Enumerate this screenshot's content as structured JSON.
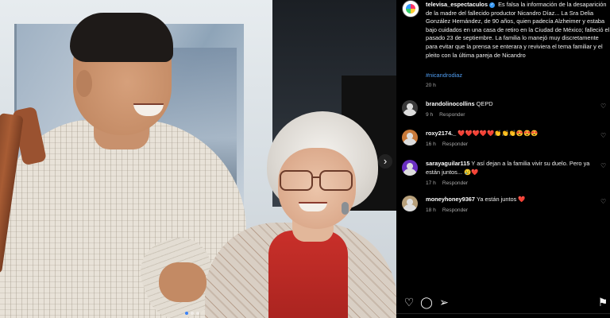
{
  "post": {
    "author": "televisa_espectaculos",
    "caption": "Es falsa la información de la desaparición de la madre del fallecido productor Nicandro Díaz... La Sra Delia González Hernández, de 90 años, quien padecía Alzheimer y estaba bajo cuidados en una casa de retiro en la Ciudad de México; falleció el pasado 23 de septiembre. La familia lo manejó muy discretamente para evitar que la prensa se enterara y reviviera el tema familiar y el pleito con la última pareja de Nicandro",
    "hashtag": "#nicandrodiaz",
    "time": "20 h",
    "verified_mark": "✓"
  },
  "carousel": {
    "next_icon": "chevron-right-icon",
    "next_glyph": "›",
    "slide_count": 3,
    "active_slide": 1
  },
  "comments": [
    {
      "user": "brandolinocollins",
      "text": "QEPD",
      "time": "9 h",
      "reply": "Responder",
      "avatar_color": "#3a3a3a"
    },
    {
      "user": "roxy2174._",
      "text": "❤️❤️❤️❤️❤️👏👏👏😍😍😍",
      "time": "16 h",
      "reply": "Responder",
      "avatar_color": "#c97a3a"
    },
    {
      "user": "sarayaguilar115",
      "text": "Y así dejan a la familia vivir su duelo. Pero ya están juntos... 😢❤️",
      "time": "17 h",
      "reply": "Responder",
      "avatar_color": "#6a2fc0"
    },
    {
      "user": "moneyhoney9367",
      "text": "Ya están juntos ❤️",
      "time": "18 h",
      "reply": "Responder",
      "avatar_color": "#b8a07a"
    }
  ],
  "actions": {
    "like_icon": "heart-icon",
    "comment_icon": "comment-icon",
    "share_icon": "paper-plane-icon",
    "save_icon": "bookmark-icon",
    "like_glyph": "♡",
    "comment_glyph": "◯",
    "share_glyph": "➢",
    "save_glyph": "⚑"
  },
  "colors": {
    "background": "#000000",
    "link": "#4f9cf0",
    "muted": "#a8a8a8",
    "verified": "#3897f0",
    "heart": "#ed4956"
  }
}
